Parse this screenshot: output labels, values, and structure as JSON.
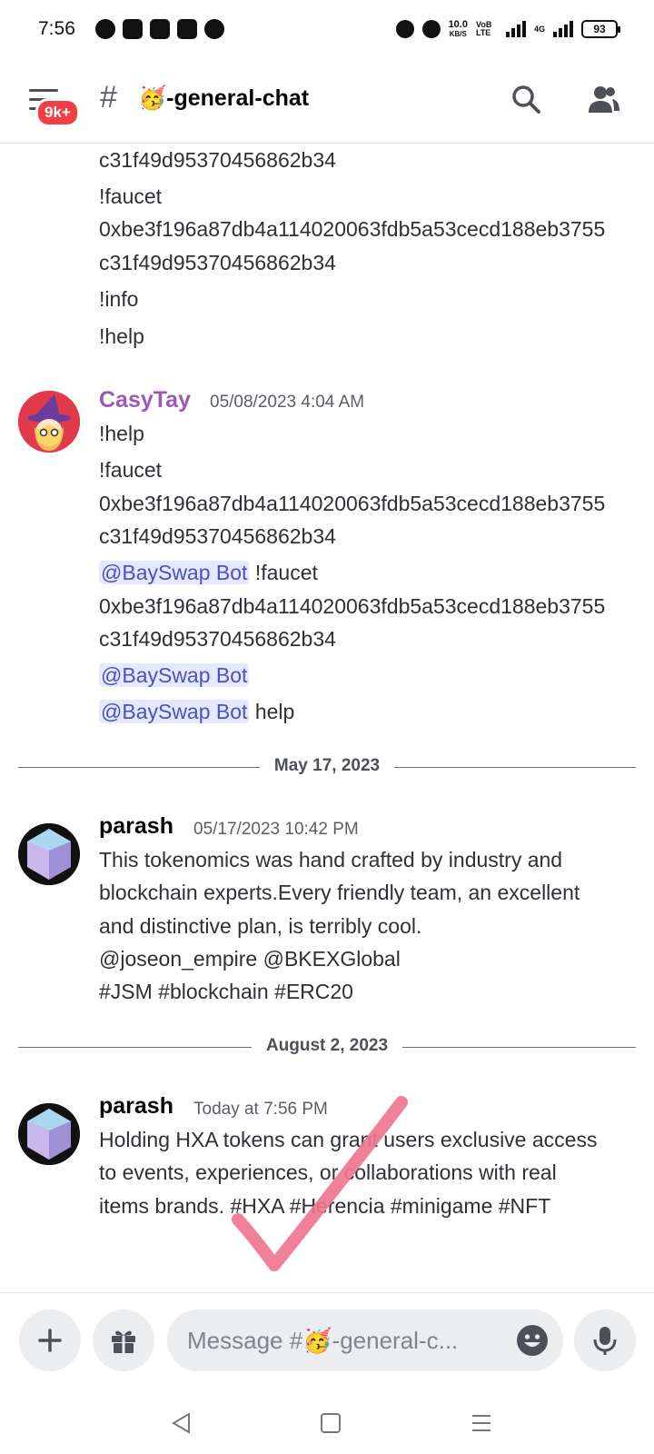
{
  "status_bar": {
    "time": "7:56",
    "net_speed": "10.0",
    "net_unit": "KB/S",
    "volte": "VoB LTE",
    "network": "4G",
    "battery": "93"
  },
  "header": {
    "badge": "9k+",
    "hash": "#",
    "channel_name": "🥳-general-chat"
  },
  "messages": {
    "top_fragment": [
      "c31f49d95370456862b34",
      "!faucet",
      "0xbe3f196a87db4a114020063fdb5a53cecd188eb3755",
      "c31f49d95370456862b34",
      "!info",
      "!help"
    ],
    "casy": {
      "username": "CasyTay",
      "username_color": "#9b59b6",
      "timestamp": "05/08/2023 4:04 AM",
      "lines": [
        "!help",
        "!faucet",
        "0xbe3f196a87db4a114020063fdb5a53cecd188eb3755",
        "c31f49d95370456862b34"
      ],
      "mention": "@BaySwap Bot",
      "mention_line1_text": " !faucet",
      "lines2": [
        "0xbe3f196a87db4a114020063fdb5a53cecd188eb3755",
        "c31f49d95370456862b34"
      ],
      "mention_line3_text": " help"
    },
    "divider1": "May 17, 2023",
    "parash1": {
      "username": "parash",
      "timestamp": "05/17/2023 10:42 PM",
      "lines": [
        "This tokenomics was hand crafted by industry and",
        "blockchain experts.Every  friendly team, an excellent",
        "and distinctive plan, is terribly cool.",
        "@joseon_empire @BKEXGlobal",
        "#JSM #blockchain #ERC20"
      ]
    },
    "divider2": "August 2, 2023",
    "parash2": {
      "username": "parash",
      "timestamp": "Today at 7:56 PM",
      "lines": [
        "Holding HXA tokens can grant users exclusive access",
        "to events, experiences, or collaborations with real",
        "items brands. #HXA #Herencia #minigame #NFT"
      ]
    }
  },
  "composer": {
    "placeholder": "Message #🥳-general-c..."
  },
  "icons": {
    "menu": "menu-icon",
    "search": "search-icon",
    "members": "members-icon",
    "add": "plus-icon",
    "gift": "gift-icon",
    "emoji": "emoji-icon",
    "mic": "mic-icon",
    "back": "back-icon",
    "home": "home-icon",
    "recents": "recents-icon"
  },
  "colors": {
    "accent": "#5865f2",
    "mention_bg": "#e6e8fd",
    "mention_text": "#4752c4",
    "badge": "#f23f43",
    "checkmark": "#f07591"
  }
}
